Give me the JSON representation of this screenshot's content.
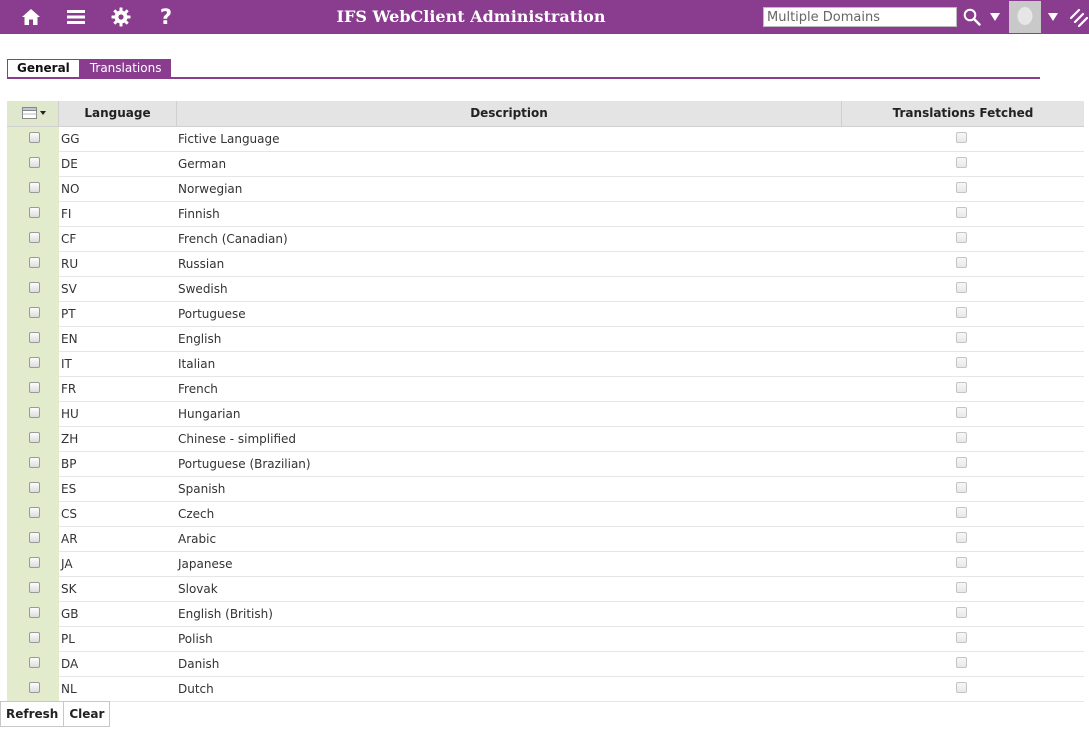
{
  "header": {
    "title": "IFS WebClient Administration",
    "domain_placeholder": "Multiple Domains",
    "icons": [
      "home-icon",
      "menu-icon",
      "gear-icon",
      "help-icon",
      "search-icon",
      "caret-down-icon",
      "avatar",
      "caret-down-icon",
      "extra-icon"
    ]
  },
  "tabs": [
    {
      "label": "General",
      "active": false
    },
    {
      "label": "Translations",
      "active": true
    }
  ],
  "table": {
    "columns": [
      "Language",
      "Description",
      "Translations Fetched"
    ],
    "rows": [
      {
        "code": "GG",
        "description": "Fictive Language",
        "selected": false,
        "fetched": false
      },
      {
        "code": "DE",
        "description": "German",
        "selected": false,
        "fetched": false
      },
      {
        "code": "NO",
        "description": "Norwegian",
        "selected": false,
        "fetched": false
      },
      {
        "code": "FI",
        "description": "Finnish",
        "selected": false,
        "fetched": false
      },
      {
        "code": "CF",
        "description": "French (Canadian)",
        "selected": false,
        "fetched": false
      },
      {
        "code": "RU",
        "description": "Russian",
        "selected": false,
        "fetched": false
      },
      {
        "code": "SV",
        "description": "Swedish",
        "selected": false,
        "fetched": false
      },
      {
        "code": "PT",
        "description": "Portuguese",
        "selected": false,
        "fetched": false
      },
      {
        "code": "EN",
        "description": "English",
        "selected": false,
        "fetched": false
      },
      {
        "code": "IT",
        "description": "Italian",
        "selected": false,
        "fetched": false
      },
      {
        "code": "FR",
        "description": "French",
        "selected": false,
        "fetched": false
      },
      {
        "code": "HU",
        "description": "Hungarian",
        "selected": false,
        "fetched": false
      },
      {
        "code": "ZH",
        "description": "Chinese - simplified",
        "selected": false,
        "fetched": false
      },
      {
        "code": "BP",
        "description": "Portuguese (Brazilian)",
        "selected": false,
        "fetched": false
      },
      {
        "code": "ES",
        "description": "Spanish",
        "selected": false,
        "fetched": false
      },
      {
        "code": "CS",
        "description": "Czech",
        "selected": false,
        "fetched": false
      },
      {
        "code": "AR",
        "description": "Arabic",
        "selected": false,
        "fetched": false
      },
      {
        "code": "JA",
        "description": "Japanese",
        "selected": false,
        "fetched": false
      },
      {
        "code": "SK",
        "description": "Slovak",
        "selected": false,
        "fetched": false
      },
      {
        "code": "GB",
        "description": "English (British)",
        "selected": false,
        "fetched": false
      },
      {
        "code": "PL",
        "description": "Polish",
        "selected": false,
        "fetched": false
      },
      {
        "code": "DA",
        "description": "Danish",
        "selected": false,
        "fetched": false
      },
      {
        "code": "NL",
        "description": "Dutch",
        "selected": false,
        "fetched": false
      }
    ]
  },
  "buttons": {
    "refresh": "Refresh",
    "clear": "Clear"
  },
  "colors": {
    "brand": "#8a3d8f",
    "selection_column": "#e2eccd",
    "header_bg": "#e4e4e4"
  }
}
